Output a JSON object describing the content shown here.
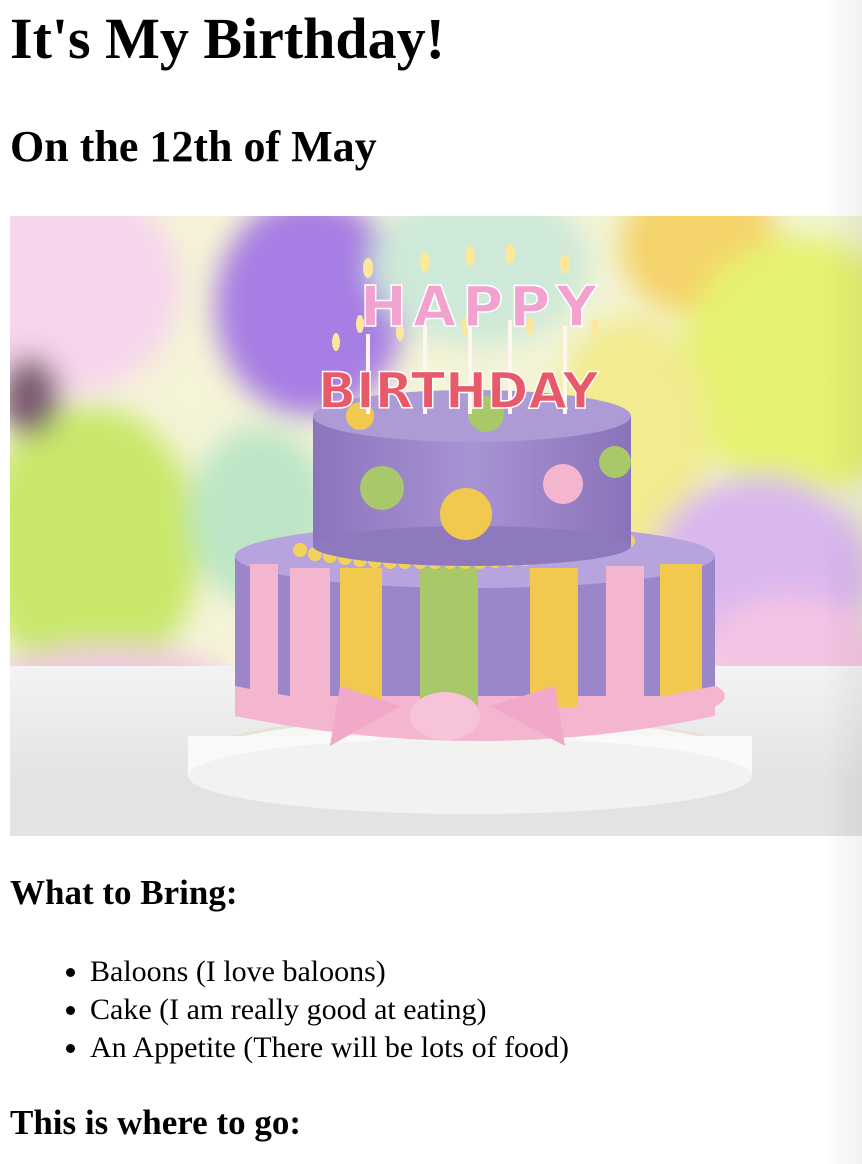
{
  "page": {
    "title": "It's My Birthday!",
    "subtitle": "On the 12th of May",
    "image": {
      "cake_top_text": "HAPPY",
      "cake_bottom_text": "BIRTHDAY"
    },
    "bring_heading": "What to Bring:",
    "bring_items": [
      "Baloons (I love baloons)",
      "Cake (I am really good at eating)",
      "An Appetite (There will be lots of food)"
    ],
    "where_heading": "This is where to go:"
  },
  "colors": {
    "text": "#000000",
    "background": "#ffffff",
    "cake_purple": "#9b86c9",
    "cake_pink": "#f4b6cf",
    "cake_yellow": "#f0c94e",
    "cake_green": "#a9c86a"
  }
}
